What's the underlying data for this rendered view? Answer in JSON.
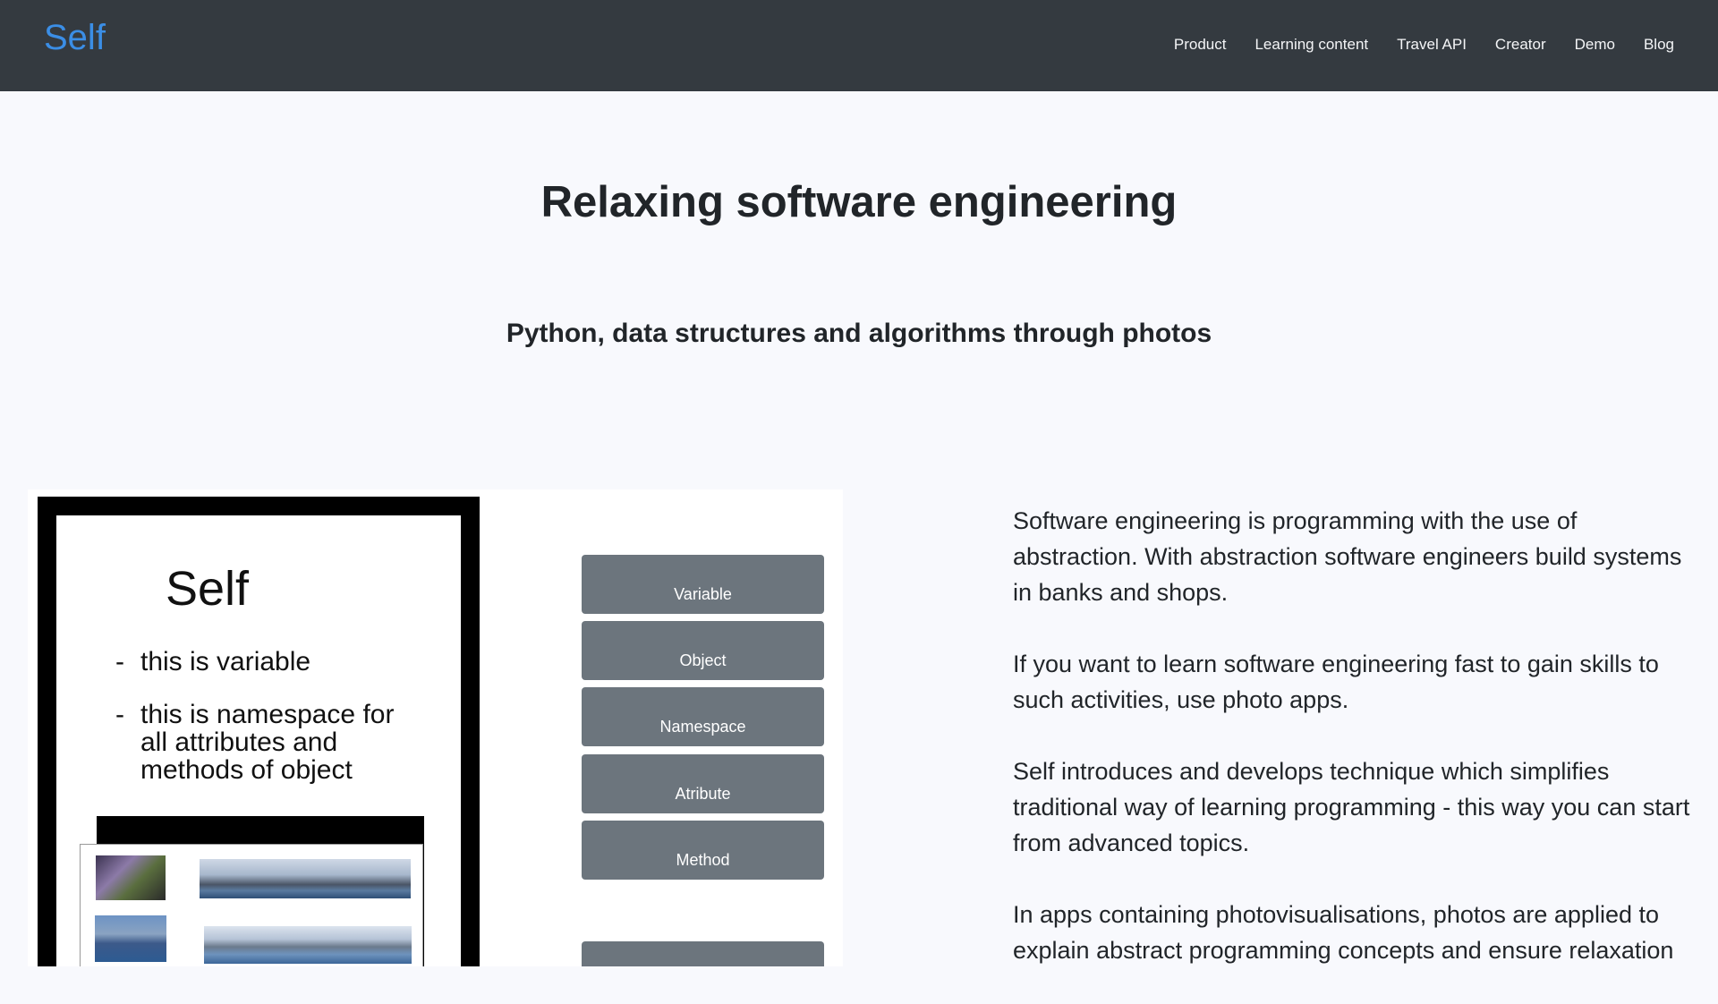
{
  "navbar": {
    "brand": "Self",
    "links": [
      "Product",
      "Learning content",
      "Travel API",
      "Creator",
      "Demo",
      "Blog"
    ]
  },
  "hero": {
    "title": "Relaxing software engineering",
    "subtitle": "Python, data structures and algorithms through photos"
  },
  "illustration": {
    "phone_title": "Self",
    "bullets": [
      {
        "dash": "-",
        "text": "this is variable"
      },
      {
        "dash": "-",
        "text": "this is namespace for all attributes and methods of object"
      }
    ],
    "concept_buttons": [
      "Variable",
      "Object",
      "Namespace",
      "Atribute",
      "Method"
    ]
  },
  "content": {
    "paragraphs": [
      "Software engineering is programming with the use of abstraction. With abstraction software engineers build systems in banks and shops.",
      "If you want to learn software engineering fast to gain skills to such activities, use photo apps.",
      "Self introduces and develops technique which simplifies traditional way of learning programming - this way you can start from advanced topics.",
      "In apps containing photovisualisations, photos are applied to explain abstract programming concepts and ensure relaxation"
    ]
  },
  "colors": {
    "navbar_bg": "#343a40",
    "brand": "#3b8ee6",
    "page_bg": "#f8f9fd",
    "button_bg": "#6c757d"
  }
}
